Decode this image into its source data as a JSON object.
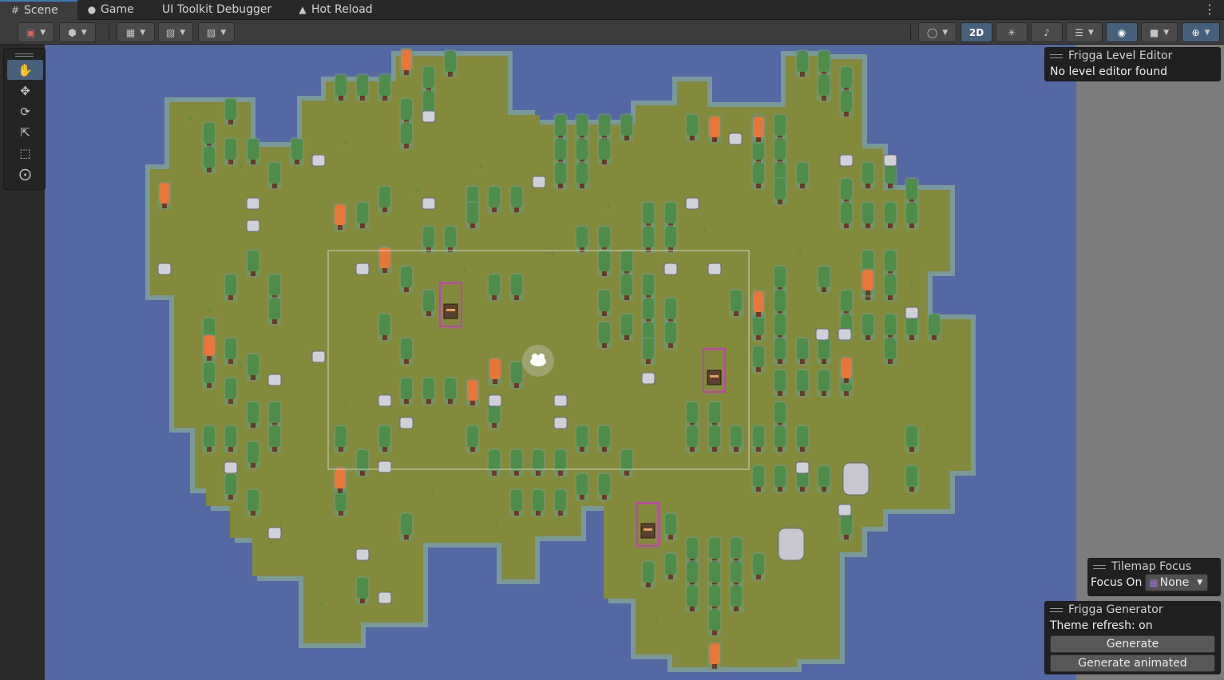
{
  "tabs": [
    {
      "label": "Scene",
      "icon": "grid-icon",
      "active": true
    },
    {
      "label": "Game",
      "icon": "gamepad-icon",
      "active": false
    },
    {
      "label": "UI Toolkit Debugger",
      "icon": "",
      "active": false
    },
    {
      "label": "Hot Reload",
      "icon": "hot-reload-icon",
      "active": false
    }
  ],
  "toolbar": {
    "mode_2d_label": "2D",
    "left_buttons": [
      "gizmo-draw-mode-icon",
      "shading-cube-icon",
      "grid-snap-icon",
      "increment-snap-icon",
      "ruler-icon"
    ],
    "right_buttons": [
      "sphere-shading-icon",
      "lighting-icon",
      "audio-icon",
      "effects-icon",
      "hidden-toggle-icon",
      "camera-icon",
      "gizmos-icon"
    ]
  },
  "tools_palette": [
    "hand-tool-icon",
    "move-tool-icon",
    "rotate-tool-icon",
    "scale-tool-icon",
    "rect-tool-icon",
    "transform-tool-icon"
  ],
  "level_editor_overlay": {
    "title": "Frigga Level Editor",
    "message": "No level editor found"
  },
  "tilemap_focus_overlay": {
    "title": "Tilemap Focus",
    "focus_label": "Focus On",
    "focus_value": "None"
  },
  "generator_overlay": {
    "title": "Frigga Generator",
    "theme_refresh": "Theme refresh: on",
    "generate_label": "Generate",
    "generate_animated_label": "Generate animated"
  },
  "colors": {
    "water": "#5468a4",
    "grass": "#848a3c",
    "tree_green": "#4e8c4a",
    "tree_orange": "#e8763a",
    "selection_magenta": "#c838c8",
    "accent": "#46607c"
  }
}
